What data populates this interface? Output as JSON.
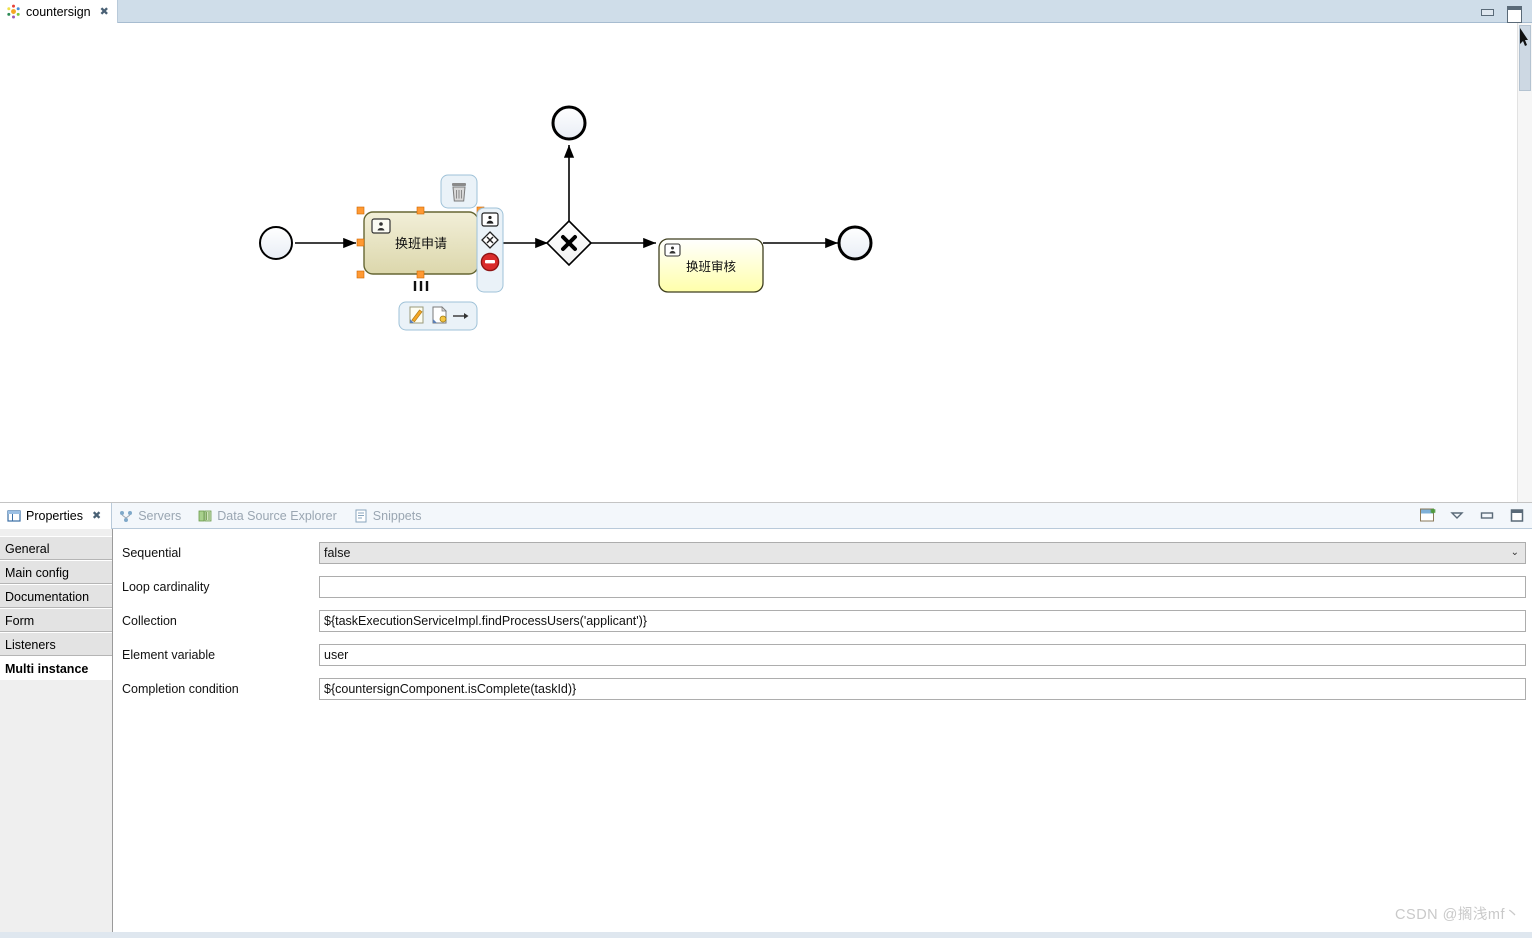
{
  "window": {
    "minimize_label": "minimize",
    "maximize_label": "maximize"
  },
  "editor": {
    "tab_label": "countersign",
    "tab_icon": "activiti-icon",
    "close_icon": "close-icon"
  },
  "diagram": {
    "type": "bpmn-process",
    "nodes": [
      {
        "id": "start-event",
        "kind": "start-event",
        "label": ""
      },
      {
        "id": "task-apply",
        "kind": "user-task",
        "label": "换班申请",
        "selected": true,
        "multi_instance_marker": "parallel"
      },
      {
        "id": "gateway-exclusive",
        "kind": "exclusive-gateway",
        "label": ""
      },
      {
        "id": "end-event-top",
        "kind": "end-event",
        "label": ""
      },
      {
        "id": "task-review",
        "kind": "user-task",
        "label": "换班审核",
        "selected": false
      },
      {
        "id": "end-event-right",
        "kind": "end-event",
        "label": ""
      }
    ],
    "selection_toolbar": {
      "delete_icon": "trash-icon",
      "user-task_icon": "user-task-icon",
      "gateway_icon": "gateway-icon",
      "end-event_icon": "end-event-icon",
      "edit_icon": "edit-icon",
      "new_icon": "new-document-icon",
      "connect_icon": "sequence-flow-arrow-icon"
    }
  },
  "properties_view": {
    "tabs": [
      {
        "label": "Properties",
        "icon": "properties-icon",
        "active": true,
        "closable": true
      },
      {
        "label": "Servers",
        "icon": "servers-icon",
        "active": false,
        "closable": false
      },
      {
        "label": "Data Source Explorer",
        "icon": "data-source-icon",
        "active": false,
        "closable": false
      },
      {
        "label": "Snippets",
        "icon": "snippets-icon",
        "active": false,
        "closable": false
      }
    ],
    "toolbar": [
      {
        "name": "restore-icon"
      },
      {
        "name": "view-menu-icon"
      },
      {
        "name": "minimize-icon"
      },
      {
        "name": "maximize-icon"
      }
    ],
    "side_tabs": [
      {
        "label": "General",
        "selected": false
      },
      {
        "label": "Main config",
        "selected": false
      },
      {
        "label": "Documentation",
        "selected": false
      },
      {
        "label": "Form",
        "selected": false
      },
      {
        "label": "Listeners",
        "selected": false
      },
      {
        "label": "Multi instance",
        "selected": true
      }
    ],
    "fields": [
      {
        "label": "Sequential",
        "type": "combo",
        "value": "false",
        "placeholder": ""
      },
      {
        "label": "Loop cardinality",
        "type": "text",
        "value": "",
        "placeholder": ""
      },
      {
        "label": "Collection",
        "type": "text",
        "value": "${taskExecutionServiceImpl.findProcessUsers('applicant')}",
        "placeholder": ""
      },
      {
        "label": "Element variable",
        "type": "text",
        "value": "user",
        "placeholder": ""
      },
      {
        "label": "Completion condition",
        "type": "text",
        "value": "${countersignComponent.isComplete(taskId)}",
        "placeholder": ""
      }
    ],
    "combo_arrow_glyph": "⌄"
  },
  "watermark": {
    "text": "CSDN @搁浅mf丶"
  }
}
